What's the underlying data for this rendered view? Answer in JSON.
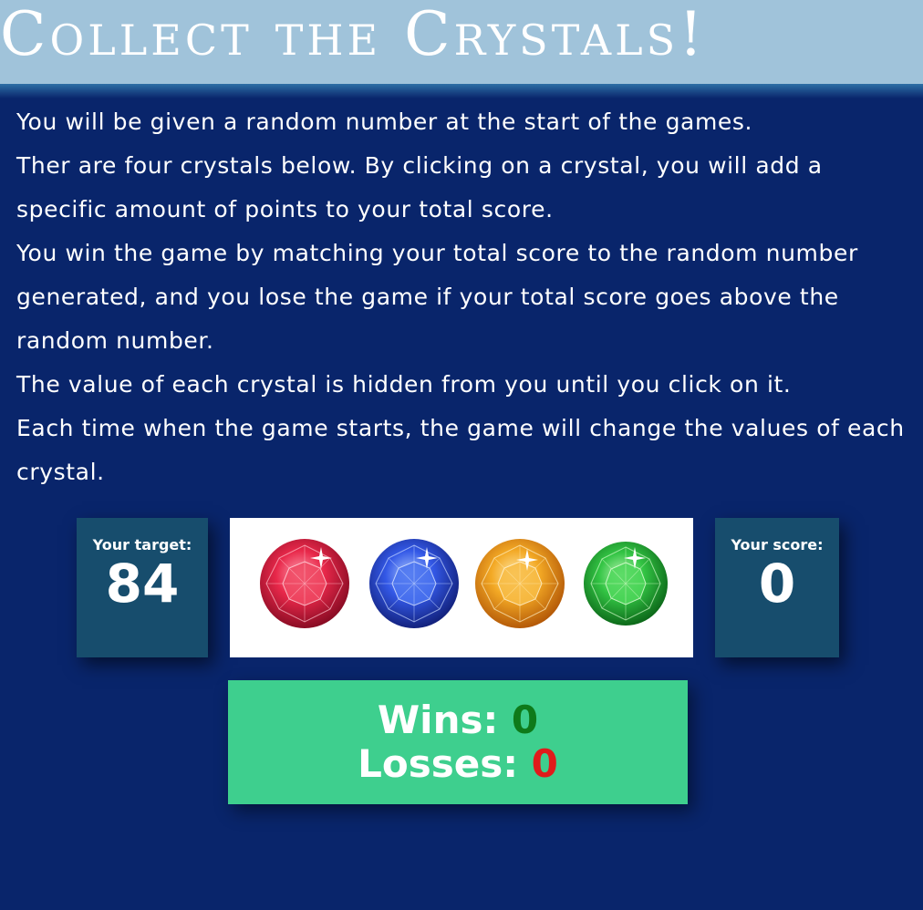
{
  "header": {
    "title": "Collect the Crystals!"
  },
  "instructions": [
    "You will be given a random number at the start of the games.",
    "Ther are four crystals below. By clicking on a crystal, you will add a specific amount of points to your total score.",
    "You win the game by matching your total score to the random number generated, and you lose the game if your total score goes above the random number.",
    "The value of each crystal is hidden from you until you click on it.",
    "Each time when the game starts, the game will change the values of each crystal."
  ],
  "target": {
    "label": "Your target:",
    "value": "84"
  },
  "score": {
    "label": "Your score:",
    "value": "0"
  },
  "crystals": [
    {
      "name": "red-crystal-icon",
      "color": "#e0243c"
    },
    {
      "name": "blue-crystal-icon",
      "color": "#2f55e0"
    },
    {
      "name": "yellow-crystal-icon",
      "color": "#f0a21c"
    },
    {
      "name": "green-crystal-icon",
      "color": "#2fbf3c"
    }
  ],
  "record": {
    "wins_label": "Wins:",
    "wins_value": "0",
    "losses_label": "Losses:",
    "losses_value": "0"
  },
  "colors": {
    "background": "#09256b",
    "header": "#a0c3da",
    "panel": "#174d6d",
    "record_panel": "#3ecf8e",
    "wins": "#0e7a1a",
    "losses": "#e01b1b"
  }
}
